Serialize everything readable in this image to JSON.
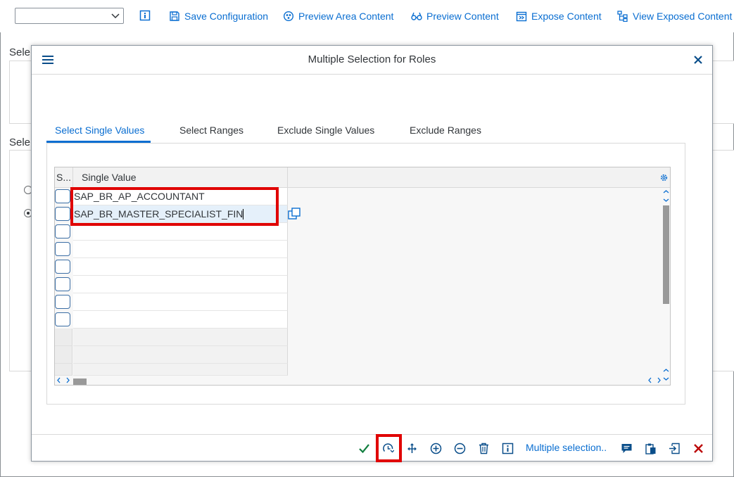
{
  "toolbar": {
    "dropdown_value": "",
    "info_icon": "info-icon",
    "buttons": [
      {
        "label": "Save Configuration",
        "icon": "save-icon"
      },
      {
        "label": "Preview Area Content",
        "icon": "preview-area-icon"
      },
      {
        "label": "Preview Content",
        "icon": "glasses-icon"
      },
      {
        "label": "Expose Content",
        "icon": "expose-icon"
      },
      {
        "label": "View Exposed Content",
        "icon": "hierarchy-icon"
      }
    ]
  },
  "background": {
    "section1_label": "Sele",
    "section2_label": "Sele"
  },
  "dialog": {
    "title": "Multiple Selection for Roles",
    "tabs": [
      {
        "label": "Select Single Values",
        "active": true
      },
      {
        "label": "Select Ranges",
        "active": false
      },
      {
        "label": "Exclude Single Values",
        "active": false
      },
      {
        "label": "Exclude Ranges",
        "active": false
      }
    ],
    "grid": {
      "col_select": "S...",
      "col_value": "Single Value",
      "rows": [
        "SAP_BR_AP_ACCOUNTANT",
        "SAP_BR_MASTER_SPECIALIST_FIN",
        "",
        "",
        "",
        "",
        "",
        ""
      ]
    },
    "footer": {
      "multiple_selection_label": "Multiple selection.."
    }
  },
  "colors": {
    "accent": "#0a6ed1",
    "highlight_red": "#e00000",
    "confirm_green": "#107e3e",
    "cancel_red": "#bb0000"
  }
}
